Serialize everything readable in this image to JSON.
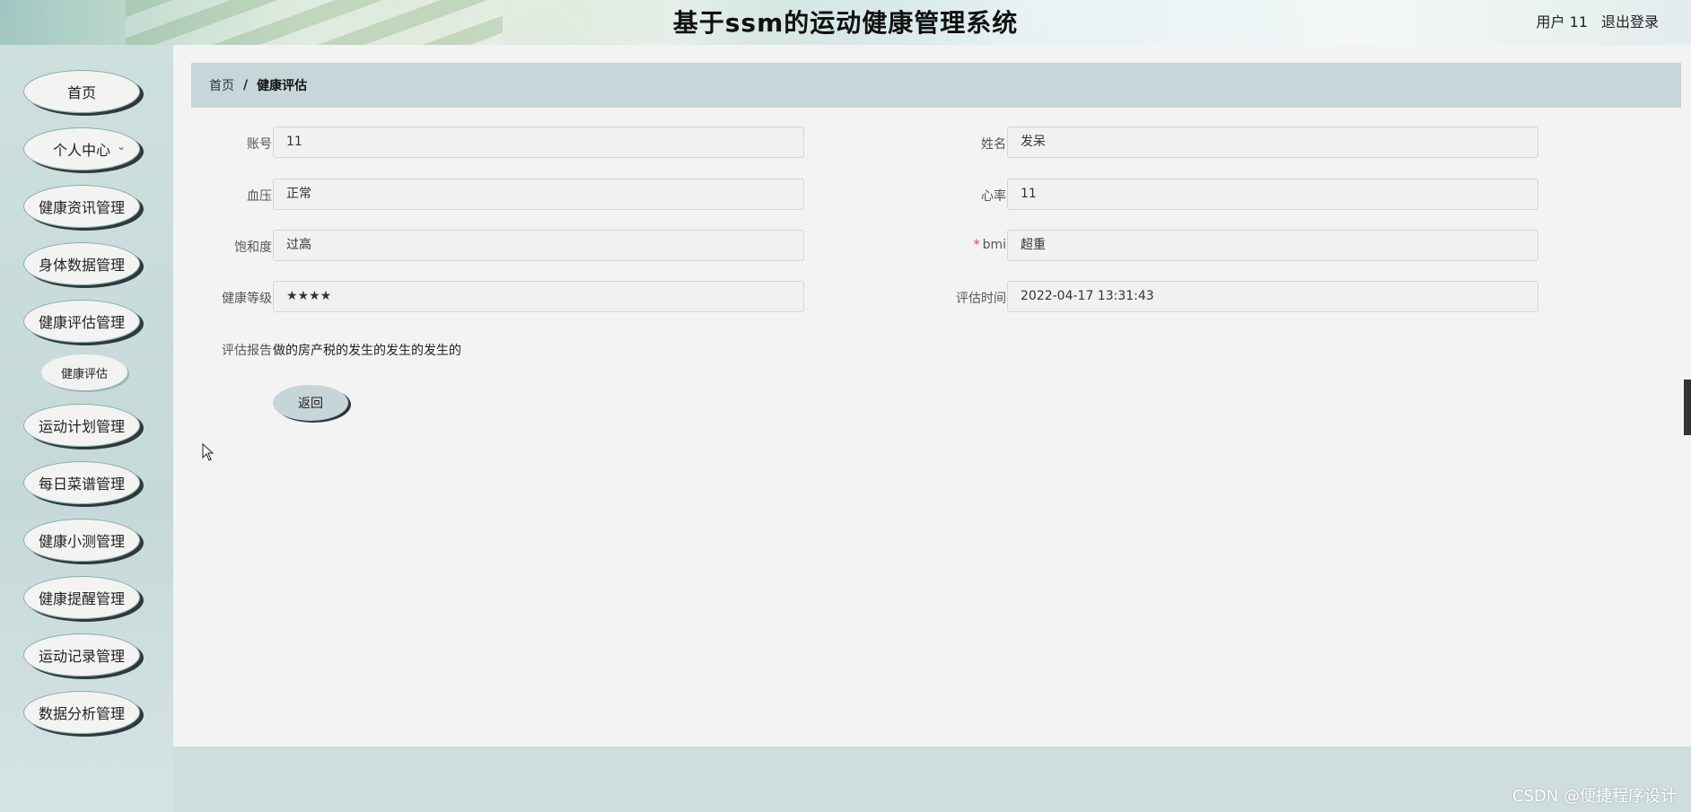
{
  "header": {
    "title": "基于ssm的运动健康管理系统",
    "user_label": "用户 11",
    "logout_label": "退出登录"
  },
  "sidebar": {
    "items": [
      {
        "label": "首页"
      },
      {
        "label": "个人中心",
        "has_submenu": true,
        "icon": "chevron-down-icon"
      },
      {
        "label": "健康资讯管理"
      },
      {
        "label": "身体数据管理"
      },
      {
        "label": "健康评估管理"
      },
      {
        "label": "健康评估",
        "submenu": true
      },
      {
        "label": "运动计划管理"
      },
      {
        "label": "每日菜谱管理"
      },
      {
        "label": "健康小测管理"
      },
      {
        "label": "健康提醒管理"
      },
      {
        "label": "运动记录管理"
      },
      {
        "label": "数据分析管理"
      }
    ]
  },
  "breadcrumb": {
    "home": "首页",
    "separator": "/",
    "current": "健康评估"
  },
  "form": {
    "account": {
      "label": "账号",
      "value": "11"
    },
    "name": {
      "label": "姓名",
      "value": "发呆"
    },
    "blood_pressure": {
      "label": "血压",
      "value": "正常"
    },
    "heart_rate": {
      "label": "心率",
      "value": "11"
    },
    "saturation": {
      "label": "饱和度",
      "value": "过高"
    },
    "bmi": {
      "label": "bmi",
      "required_mark": "*",
      "value": "超重"
    },
    "health_level": {
      "label": "健康等级",
      "value": "★★★★"
    },
    "eval_time": {
      "label": "评估时间",
      "value": "2022-04-17 13:31:43"
    },
    "report": {
      "label": "评估报告",
      "value": "做的房产税的发生的发生的发生的"
    },
    "back_label": "返回"
  },
  "watermark": "CSDN @便捷程序设计"
}
